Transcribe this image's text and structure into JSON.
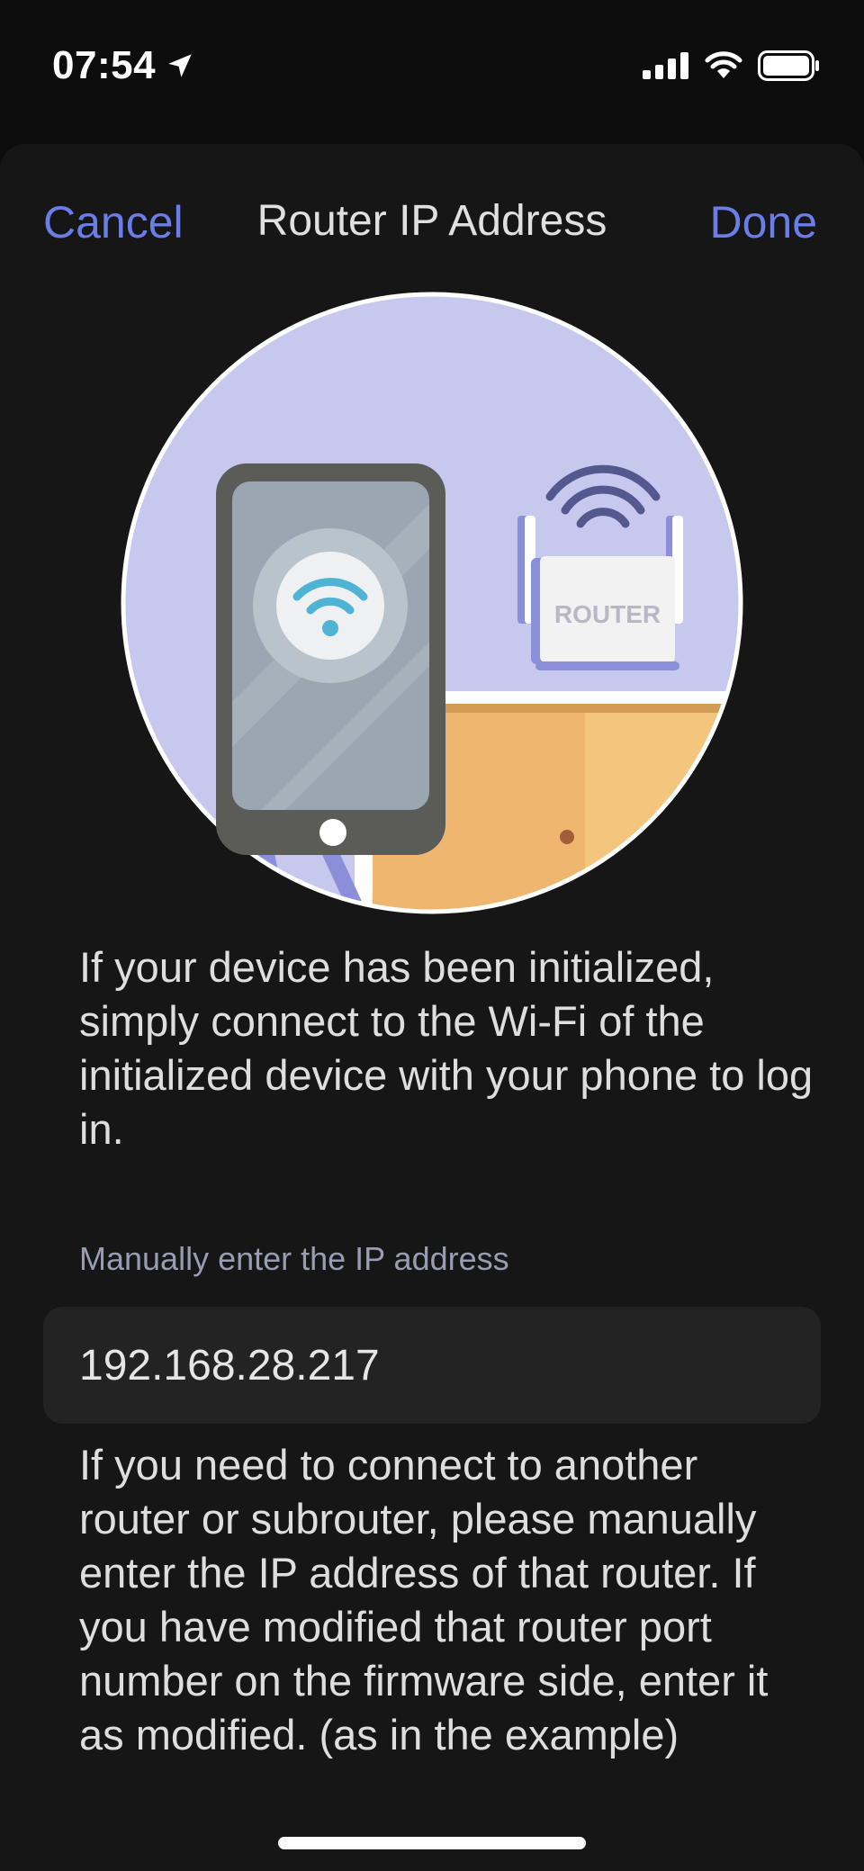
{
  "status_bar": {
    "time": "07:54",
    "icons": [
      "location-arrow-icon",
      "cellular-signal-icon",
      "wifi-icon",
      "battery-icon"
    ]
  },
  "nav": {
    "cancel_label": "Cancel",
    "title": "Router IP Address",
    "done_label": "Done"
  },
  "illustration": {
    "router_label": "ROUTER",
    "icons": [
      "phone-icon",
      "wifi-icon",
      "router-icon"
    ]
  },
  "description": "If your device has been initialized, simply connect to the Wi-Fi of the initialized device with your phone to log in.",
  "ip_section": {
    "label": "Manually enter the IP address",
    "value": "192.168.28.217"
  },
  "help_text": "If you need to connect to another router or subrouter, please manually enter the IP address of that router. If you have modified that router port number on the firmware side, enter it as modified. (as in the example)",
  "colors": {
    "accent": "#6a7de8",
    "background": "#161616",
    "field": "#232323",
    "illustration_bg": "#c6c8ee"
  }
}
